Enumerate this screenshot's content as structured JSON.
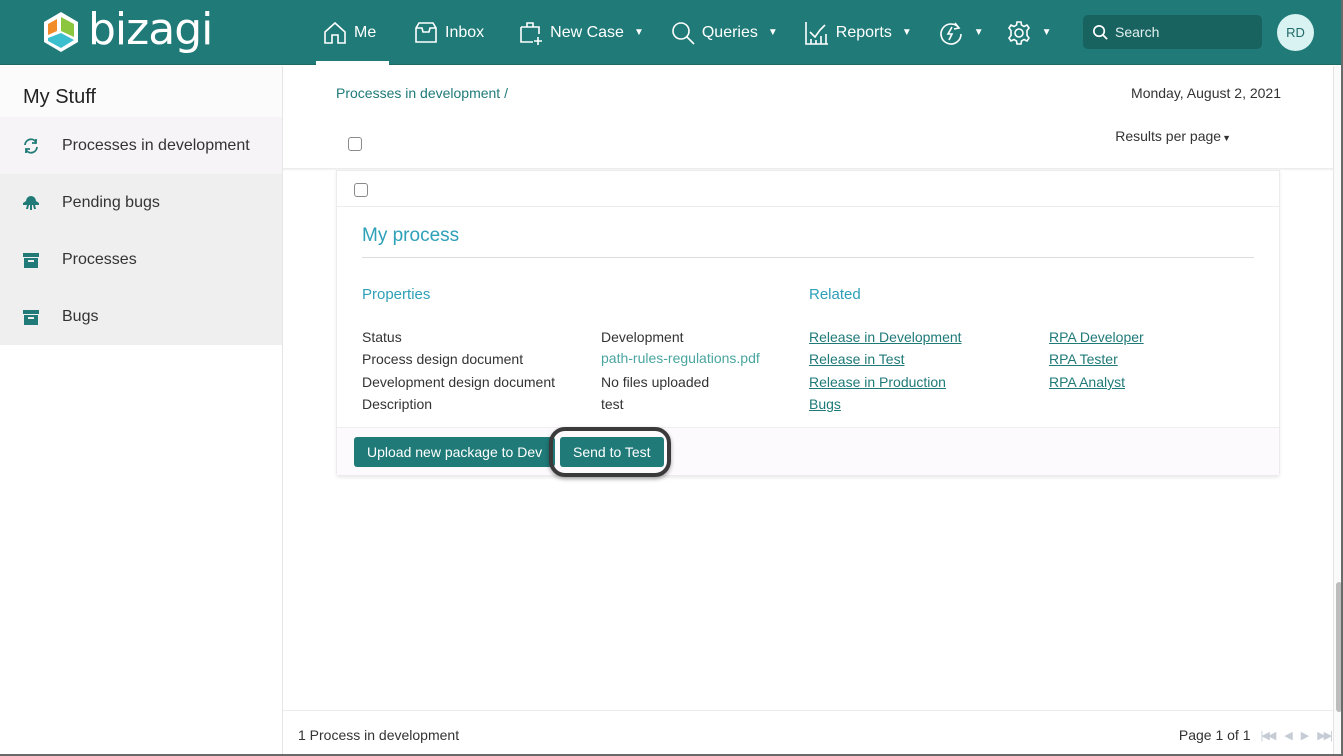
{
  "app": {
    "brand": "bizagi"
  },
  "nav": {
    "items": [
      {
        "label": "Me",
        "icon": "home-icon",
        "active": true
      },
      {
        "label": "Inbox",
        "icon": "inbox-icon"
      },
      {
        "label": "New Case",
        "icon": "new-case-icon",
        "dropdown": true
      },
      {
        "label": "Queries",
        "icon": "search-icon",
        "dropdown": true
      },
      {
        "label": "Reports",
        "icon": "chart-icon",
        "dropdown": true
      },
      {
        "label": "",
        "icon": "automation-icon",
        "dropdown": true
      },
      {
        "label": "",
        "icon": "gear-icon",
        "dropdown": true
      }
    ],
    "search_placeholder": "Search",
    "avatar_initials": "RD"
  },
  "sidebar": {
    "title": "My Stuff",
    "items": [
      {
        "label": "Processes in development",
        "icon": "refresh-icon",
        "active": true
      },
      {
        "label": "Pending bugs",
        "icon": "bug-icon"
      },
      {
        "label": "Processes",
        "icon": "archive-icon"
      },
      {
        "label": "Bugs",
        "icon": "archive-icon"
      }
    ]
  },
  "main": {
    "breadcrumb": "Processes in development /",
    "date": "Monday, August 2, 2021",
    "results_per_page_label": "Results per page",
    "card": {
      "title": "My process",
      "properties_title": "Properties",
      "related_title": "Related",
      "properties": [
        {
          "label": "Status",
          "value": "Development",
          "is_link": false
        },
        {
          "label": "Process design document",
          "value": "path-rules-regulations.pdf",
          "is_link": true
        },
        {
          "label": "Development design document",
          "value": "No files uploaded",
          "is_link": false
        },
        {
          "label": "Description",
          "value": "test",
          "is_link": false
        }
      ],
      "related_col1": [
        "Release in Development",
        "Release in Test",
        "Release in Production",
        "Bugs"
      ],
      "related_col2": [
        "RPA Developer",
        "RPA Tester",
        "RPA Analyst"
      ],
      "buttons": {
        "upload": "Upload new package to Dev",
        "send_test": "Send to Test"
      }
    },
    "footer": {
      "count": "1 Process in development",
      "page": "Page 1 of 1",
      "pager": {
        "first": "⏮",
        "prev": "◀",
        "next": "▶",
        "last": "⏭"
      }
    }
  },
  "colors": {
    "brand": "#1f7a78",
    "accent_heading": "#2ea0b8",
    "link": "#1f7a78"
  }
}
